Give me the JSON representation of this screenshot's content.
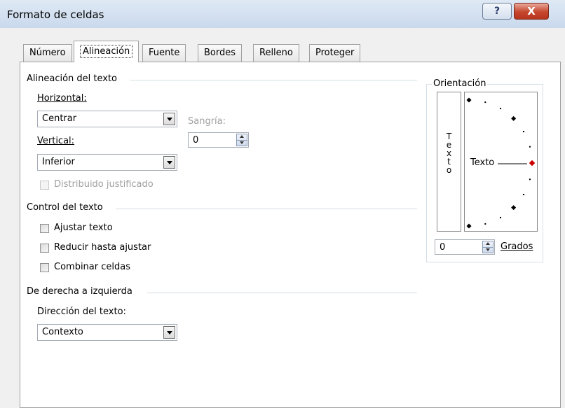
{
  "window": {
    "title": "Formato de celdas",
    "help_glyph": "?",
    "close_glyph": "X"
  },
  "tabs": [
    {
      "label": "Número"
    },
    {
      "label": "Alineación",
      "active": true
    },
    {
      "label": "Fuente"
    },
    {
      "label": "Bordes"
    },
    {
      "label": "Relleno"
    },
    {
      "label": "Proteger"
    }
  ],
  "text_alignment": {
    "group_label": "Alineación del texto",
    "horizontal_label": "Horizontal:",
    "horizontal_value": "Centrar",
    "indent_label": "Sangría:",
    "indent_value": "0",
    "vertical_label": "Vertical:",
    "vertical_value": "Inferior",
    "distributed_label": "Distribuido justificado"
  },
  "text_control": {
    "group_label": "Control del texto",
    "wrap_label": "Ajustar texto",
    "shrink_label": "Reducir hasta ajustar",
    "merge_label": "Combinar celdas"
  },
  "rtl": {
    "group_label": "De derecha a izquierda",
    "direction_label": "Dirección del texto:",
    "direction_value": "Contexto"
  },
  "orientation": {
    "group_label": "Orientación",
    "vertical_text": "Texto",
    "dial_text": "Texto",
    "degrees_value": "0",
    "degrees_label": "Grados",
    "accent_color": "#cc0000"
  }
}
